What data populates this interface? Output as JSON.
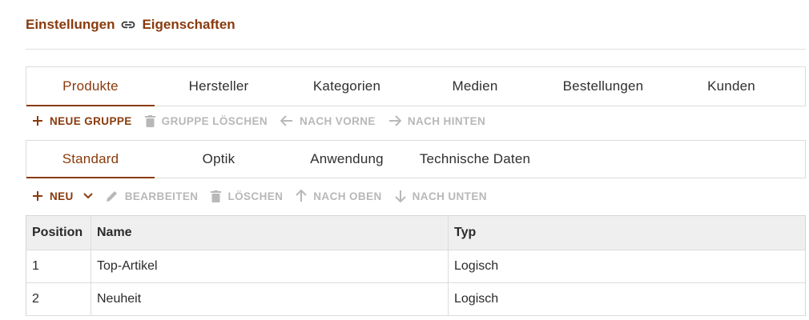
{
  "breadcrumb": {
    "parent": "Einstellungen",
    "current": "Eigenschaften",
    "separator_icon": "link-icon"
  },
  "main_tabs": [
    {
      "label": "Produkte",
      "active": true
    },
    {
      "label": "Hersteller",
      "active": false
    },
    {
      "label": "Kategorien",
      "active": false
    },
    {
      "label": "Medien",
      "active": false
    },
    {
      "label": "Bestellungen",
      "active": false
    },
    {
      "label": "Kunden",
      "active": false
    }
  ],
  "group_toolbar": {
    "new_group": "NEUE GRUPPE",
    "delete_group": "GRUPPE LÖSCHEN",
    "move_forward": "NACH VORNE",
    "move_back": "NACH HINTEN"
  },
  "sub_tabs": [
    {
      "label": "Standard",
      "active": true
    },
    {
      "label": "Optik",
      "active": false
    },
    {
      "label": "Anwendung",
      "active": false
    },
    {
      "label": "Technische Daten",
      "active": false
    }
  ],
  "item_toolbar": {
    "new": "NEU",
    "edit": "BEARBEITEN",
    "delete": "LÖSCHEN",
    "move_up": "NACH OBEN",
    "move_down": "NACH UNTEN"
  },
  "table": {
    "headers": {
      "position": "Position",
      "name": "Name",
      "type": "Typ"
    },
    "rows": [
      {
        "position": "1",
        "name": "Top-Artikel",
        "type": "Logisch"
      },
      {
        "position": "2",
        "name": "Neuheit",
        "type": "Logisch"
      }
    ]
  },
  "colors": {
    "accent": "#8a3a0c",
    "disabled": "#b8b8b8",
    "header_bg": "#efefef",
    "border": "#dcdcdc"
  }
}
